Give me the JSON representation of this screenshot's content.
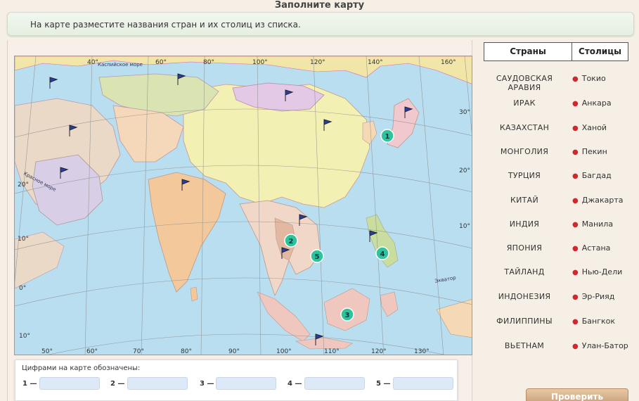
{
  "header": {
    "title": "Заполните карту",
    "instruction": "На карте разместите названия стран и их столиц из списка."
  },
  "map": {
    "longitude_labels_top": [
      "40°",
      "60°",
      "80°",
      "100°",
      "120°",
      "140°",
      "160°"
    ],
    "longitude_labels_bottom": [
      "50°",
      "60°",
      "70°",
      "80°",
      "90°",
      "100°",
      "110°",
      "120°",
      "130°"
    ],
    "latitude_labels_right": [
      "30°",
      "20°",
      "10°"
    ],
    "latitude_labels_left": [
      "20°",
      "10°",
      "0°",
      "10°"
    ],
    "water_labels": [
      "Каспийское море",
      "Красное море",
      "Экватор"
    ],
    "markers": [
      "1",
      "2",
      "3",
      "4",
      "5"
    ],
    "colors": {
      "ocean": "#b9def0",
      "marker": "#2ec39a"
    }
  },
  "legend": {
    "countries_header": "Страны",
    "capitals_header": "Столицы",
    "countries": [
      "САУДОВСКАЯ АРАВИЯ",
      "ИРАК",
      "КАЗАХСТАН",
      "МОНГОЛИЯ",
      "ТУРЦИЯ",
      "КИТАЙ",
      "ИНДИЯ",
      "ЯПОНИЯ",
      "ТАЙЛАНД",
      "ИНДОНЕЗИЯ",
      "ФИЛИППИНЫ",
      "ВЬЕТНАМ"
    ],
    "capitals": [
      "Токио",
      "Анкара",
      "Ханой",
      "Пекин",
      "Багдад",
      "Джакарта",
      "Манила",
      "Астана",
      "Нью-Дели",
      "Эр-Рияд",
      "Бангкок",
      "Улан-Батор"
    ]
  },
  "answers": {
    "caption": "Цифрами на карте обозначены:",
    "slots": [
      "1 —",
      "2 —",
      "3 —",
      "4 —",
      "5 —"
    ]
  },
  "actions": {
    "check_label": "Проверить"
  }
}
